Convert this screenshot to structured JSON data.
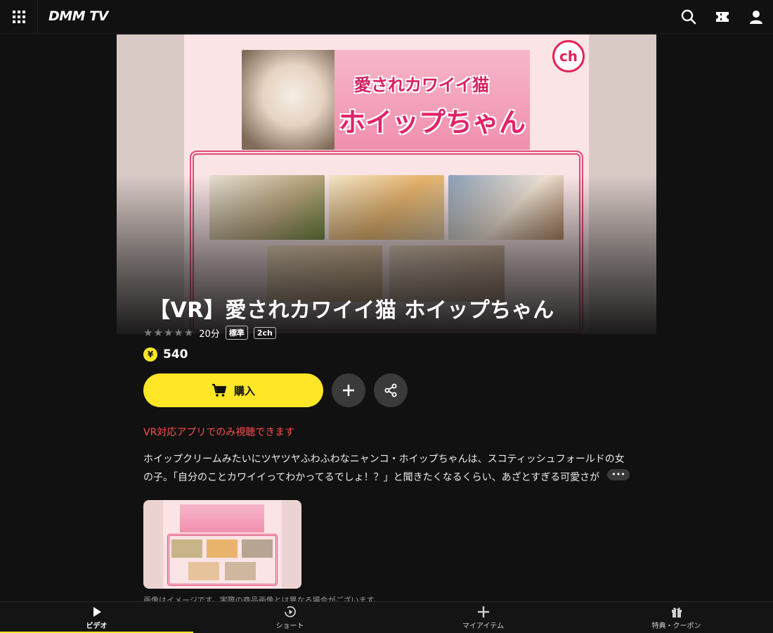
{
  "header": {
    "logo": "DMM TV",
    "icons": [
      "grid-menu-icon",
      "search-icon",
      "ticket-icon",
      "user-icon"
    ]
  },
  "hero": {
    "banner_line1": "愛されカワイイ猫",
    "banner_line2": "ホイップちゃん",
    "channel_badge": "ch"
  },
  "title": "【VR】愛されカワイイ猫 ホイップちゃん",
  "meta": {
    "rating_stars": 5,
    "duration": "20分",
    "tag_quality": "標準",
    "tag_audio": "2ch"
  },
  "price": {
    "currency_symbol": "¥",
    "amount": "540"
  },
  "actions": {
    "buy_label": "購入"
  },
  "notice": "VR対応アプリでのみ視聴できます",
  "description": "ホイップクリームみたいにツヤツヤふわふわなニャンコ・ホイップちゃんは、スコティッシュフォールドの女の子。「自分のことカワイイってわかってるでしょ！？」と聞きたくなるくらい、あざとすぎる可愛さが",
  "more_label": "•••",
  "thumbnail_caption": "画像はイメージです。実際の商品画像とは異なる場合がございます。",
  "bottom_nav": [
    {
      "label": "ビデオ",
      "icon": "play-icon",
      "active": true
    },
    {
      "label": "ショート",
      "icon": "short-play-icon",
      "active": false
    },
    {
      "label": "マイアイテム",
      "icon": "plus-icon",
      "active": false
    },
    {
      "label": "特典・クーポン",
      "icon": "gift-icon",
      "active": false
    }
  ],
  "colors": {
    "accent": "#ffe626",
    "background": "#111111",
    "notice": "#ff4d4d"
  }
}
